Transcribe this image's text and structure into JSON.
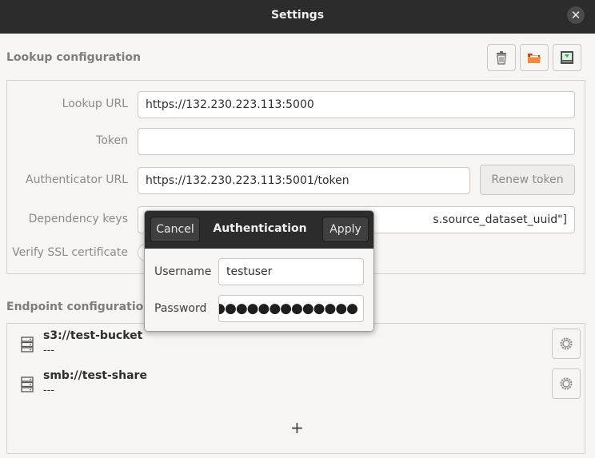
{
  "window": {
    "title": "Settings",
    "close_icon": "close-icon"
  },
  "lookup": {
    "section_title": "Lookup configuration",
    "toolbar": {
      "delete_icon": "trash-icon",
      "open_icon": "folder-open-icon",
      "save_icon": "save-download-icon"
    },
    "fields": {
      "lookup_url_label": "Lookup URL",
      "lookup_url_value": "https://132.230.223.113:5000",
      "token_label": "Token",
      "token_value": "",
      "authenticator_url_label": "Authenticator URL",
      "authenticator_url_value": "https://132.230.223.113:5001/token",
      "renew_token_label": "Renew token",
      "dependency_keys_label": "Dependency keys",
      "dependency_keys_visible_value": "s.source_dataset_uuid\"]",
      "verify_ssl_label": "Verify SSL certificate"
    }
  },
  "endpoints": {
    "section_title": "Endpoint configuration",
    "items": [
      {
        "name": "s3://test-bucket",
        "subtitle": "---",
        "icon": "server-icon",
        "settings_icon": "gear-icon"
      },
      {
        "name": "smb://test-share",
        "subtitle": "---",
        "icon": "server-icon",
        "settings_icon": "gear-icon"
      }
    ],
    "add_label": "+"
  },
  "auth_popover": {
    "title": "Authentication",
    "cancel_label": "Cancel",
    "apply_label": "Apply",
    "username_label": "Username",
    "username_value": "testuser",
    "password_label": "Password",
    "password_masked": "●●●●●●●●●●●●●●"
  },
  "colors": {
    "titlebar": "#2c2c2c",
    "background": "#f6f5f4",
    "accent_orange": "#e95420"
  }
}
